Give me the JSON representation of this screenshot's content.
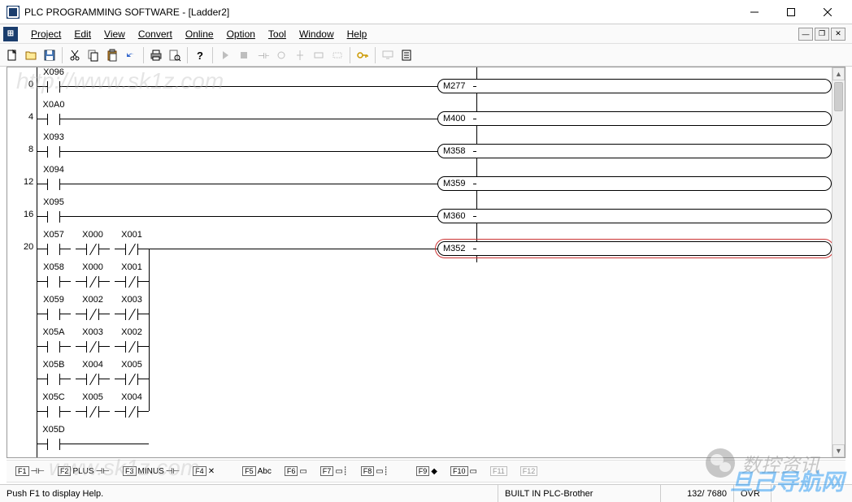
{
  "window": {
    "title": "PLC PROGRAMMING SOFTWARE - [Ladder2]"
  },
  "menu": {
    "project": "Project",
    "edit": "Edit",
    "view": "View",
    "convert": "Convert",
    "online": "Online",
    "option": "Option",
    "tool": "Tool",
    "window": "Window",
    "help": "Help"
  },
  "toolbar_icons": {
    "new": "new-file",
    "open": "open-file",
    "save": "save",
    "cut": "cut",
    "copy": "copy",
    "paste": "paste",
    "undo": "undo",
    "print": "print",
    "preview": "preview",
    "help": "help",
    "run": "run",
    "stop": "stop",
    "contact": "contact",
    "coil": "coil",
    "vrule": "vrule",
    "hrule": "hrule",
    "delete": "delete",
    "key": "key",
    "monitor": "monitor",
    "list": "list"
  },
  "rungs": [
    {
      "num": "0",
      "contacts": [
        {
          "label": "X096",
          "type": "no"
        }
      ],
      "coil": "M277"
    },
    {
      "num": "4",
      "contacts": [
        {
          "label": "X0A0",
          "type": "no"
        }
      ],
      "coil": "M400"
    },
    {
      "num": "8",
      "contacts": [
        {
          "label": "X093",
          "type": "no"
        }
      ],
      "coil": "M358"
    },
    {
      "num": "12",
      "contacts": [
        {
          "label": "X094",
          "type": "no"
        }
      ],
      "coil": "M359"
    },
    {
      "num": "16",
      "contacts": [
        {
          "label": "X095",
          "type": "no"
        }
      ],
      "coil": "M360"
    },
    {
      "num": "20",
      "contacts": [
        {
          "label": "X057",
          "type": "no"
        },
        {
          "label": "X000",
          "type": "nc"
        },
        {
          "label": "X001",
          "type": "nc"
        }
      ],
      "coil": "M352",
      "selected": true,
      "branches": [
        [
          {
            "label": "X058",
            "type": "no"
          },
          {
            "label": "X000",
            "type": "nc"
          },
          {
            "label": "X001",
            "type": "nc"
          }
        ],
        [
          {
            "label": "X059",
            "type": "no"
          },
          {
            "label": "X002",
            "type": "nc"
          },
          {
            "label": "X003",
            "type": "nc"
          }
        ],
        [
          {
            "label": "X05A",
            "type": "no"
          },
          {
            "label": "X003",
            "type": "nc"
          },
          {
            "label": "X002",
            "type": "nc"
          }
        ],
        [
          {
            "label": "X05B",
            "type": "no"
          },
          {
            "label": "X004",
            "type": "nc"
          },
          {
            "label": "X005",
            "type": "nc"
          }
        ],
        [
          {
            "label": "X05C",
            "type": "no"
          },
          {
            "label": "X005",
            "type": "nc"
          },
          {
            "label": "X004",
            "type": "nc"
          }
        ],
        [
          {
            "label": "X05D",
            "type": "no"
          }
        ]
      ]
    }
  ],
  "fnkeys": {
    "f1": "F1",
    "f1g": "⊣⊢",
    "f2": "F2",
    "f2g": "PLUS",
    "f3": "F3",
    "f3g": "MINUS",
    "f4": "F4",
    "f4g": "✕",
    "f5": "F5",
    "f5g": "Abc",
    "f6": "F6",
    "f6g": "▭",
    "f7": "F7",
    "f7g": "▭┊",
    "f8": "F8",
    "f8g": "▭┊",
    "f9": "F9",
    "f9g": "◆",
    "f10": "F10",
    "f10g": "▭",
    "f11": "F11",
    "f11g": "",
    "f12": "F12",
    "f12g": ""
  },
  "status": {
    "help": "Push F1 to display Help.",
    "plc": "BUILT IN PLC-Brother",
    "step": "132/ 7680",
    "mode": "OVR"
  },
  "watermarks": {
    "url1": "http://www.sk1z.com",
    "url2": "www.sk1z.com",
    "wechat": "数控资讯",
    "banner": "旦己导航网"
  }
}
